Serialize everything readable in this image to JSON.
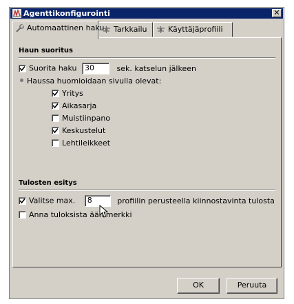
{
  "window": {
    "title": "Agenttikonfigurointi",
    "close_glyph": "✕"
  },
  "tabs": [
    {
      "label": "Automaattinen haku",
      "icon": "wrench-icon",
      "active": true
    },
    {
      "label": "Tarkkailu",
      "icon": "network-icon",
      "active": false
    },
    {
      "label": "Käyttäjäprofiili",
      "icon": "network-icon",
      "active": false
    }
  ],
  "search": {
    "heading": "Haun suoritus",
    "run_label": "Suorita haku",
    "run_checked": true,
    "seconds_value": "30",
    "seconds_suffix": "sek. katselun jälkeen",
    "considered_label": "Haussa huomioidaan sivulla olevat:",
    "options": [
      {
        "label": "Yritys",
        "checked": true
      },
      {
        "label": "Aikasarja",
        "checked": true
      },
      {
        "label": "Muistiinpano",
        "checked": false
      },
      {
        "label": "Keskustelut",
        "checked": true
      },
      {
        "label": "Lehtileikkeet",
        "checked": false
      }
    ]
  },
  "results": {
    "heading": "Tulosten esitys",
    "select_max_label": "Valitse max.",
    "select_max_checked": true,
    "max_value": "8",
    "max_suffix": "profiilin perusteella kiinnostavinta tulosta",
    "sound_label": "Anna tuloksista äänimerkki",
    "sound_checked": false
  },
  "buttons": {
    "ok": "OK",
    "cancel": "Peruuta"
  }
}
